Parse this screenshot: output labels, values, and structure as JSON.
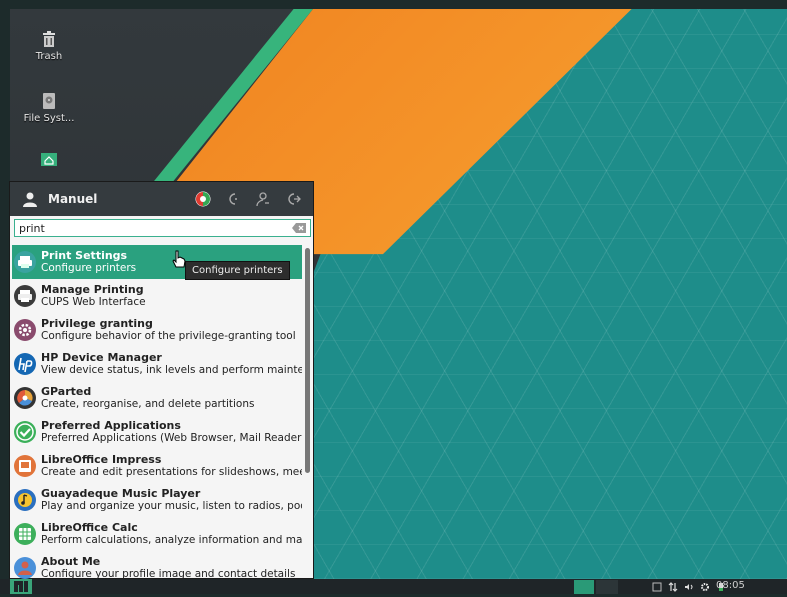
{
  "desktop": {
    "icons": [
      {
        "label": "Trash"
      },
      {
        "label": "File Syst..."
      },
      {
        "label": ""
      }
    ]
  },
  "menu": {
    "user_name": "Manuel",
    "search": {
      "value": "print"
    },
    "items": [
      {
        "title": "Print Settings",
        "desc": "Configure printers",
        "icon": "printer-settings-icon",
        "color": "#3aa3a0"
      },
      {
        "title": "Manage Printing",
        "desc": "CUPS Web Interface",
        "icon": "printer-icon",
        "color": "#3b3b3b"
      },
      {
        "title": "Privilege granting",
        "desc": "Configure behavior of the privilege-granting tool",
        "icon": "gear-icon",
        "color": "#8a4b6d"
      },
      {
        "title": "HP Device Manager",
        "desc": "View device status, ink levels and perform maintenance.",
        "icon": "hp-icon",
        "color": "#1467b3"
      },
      {
        "title": "GParted",
        "desc": "Create, reorganise, and delete partitions",
        "icon": "gparted-icon",
        "color": "#333"
      },
      {
        "title": "Preferred Applications",
        "desc": "Preferred Applications (Web Browser, Mail Reader and ...",
        "icon": "check-icon",
        "color": "#3bb05a"
      },
      {
        "title": "LibreOffice Impress",
        "desc": "Create and edit presentations for slideshows, meeting ...",
        "icon": "impress-icon",
        "color": "#e1743a"
      },
      {
        "title": "Guayadeque Music Player",
        "desc": "Play and organize your music, listen to radios, podcasts...",
        "icon": "music-player-icon",
        "color": "#2a6fbf"
      },
      {
        "title": "LibreOffice Calc",
        "desc": "Perform calculations, analyze information and manage li...",
        "icon": "calc-icon",
        "color": "#3daf5b"
      },
      {
        "title": "About Me",
        "desc": "Configure your profile image and contact details",
        "icon": "user-card-icon",
        "color": "#d2604c"
      }
    ],
    "tooltip": "Configure printers"
  },
  "taskbar": {
    "clock": "08:05"
  }
}
